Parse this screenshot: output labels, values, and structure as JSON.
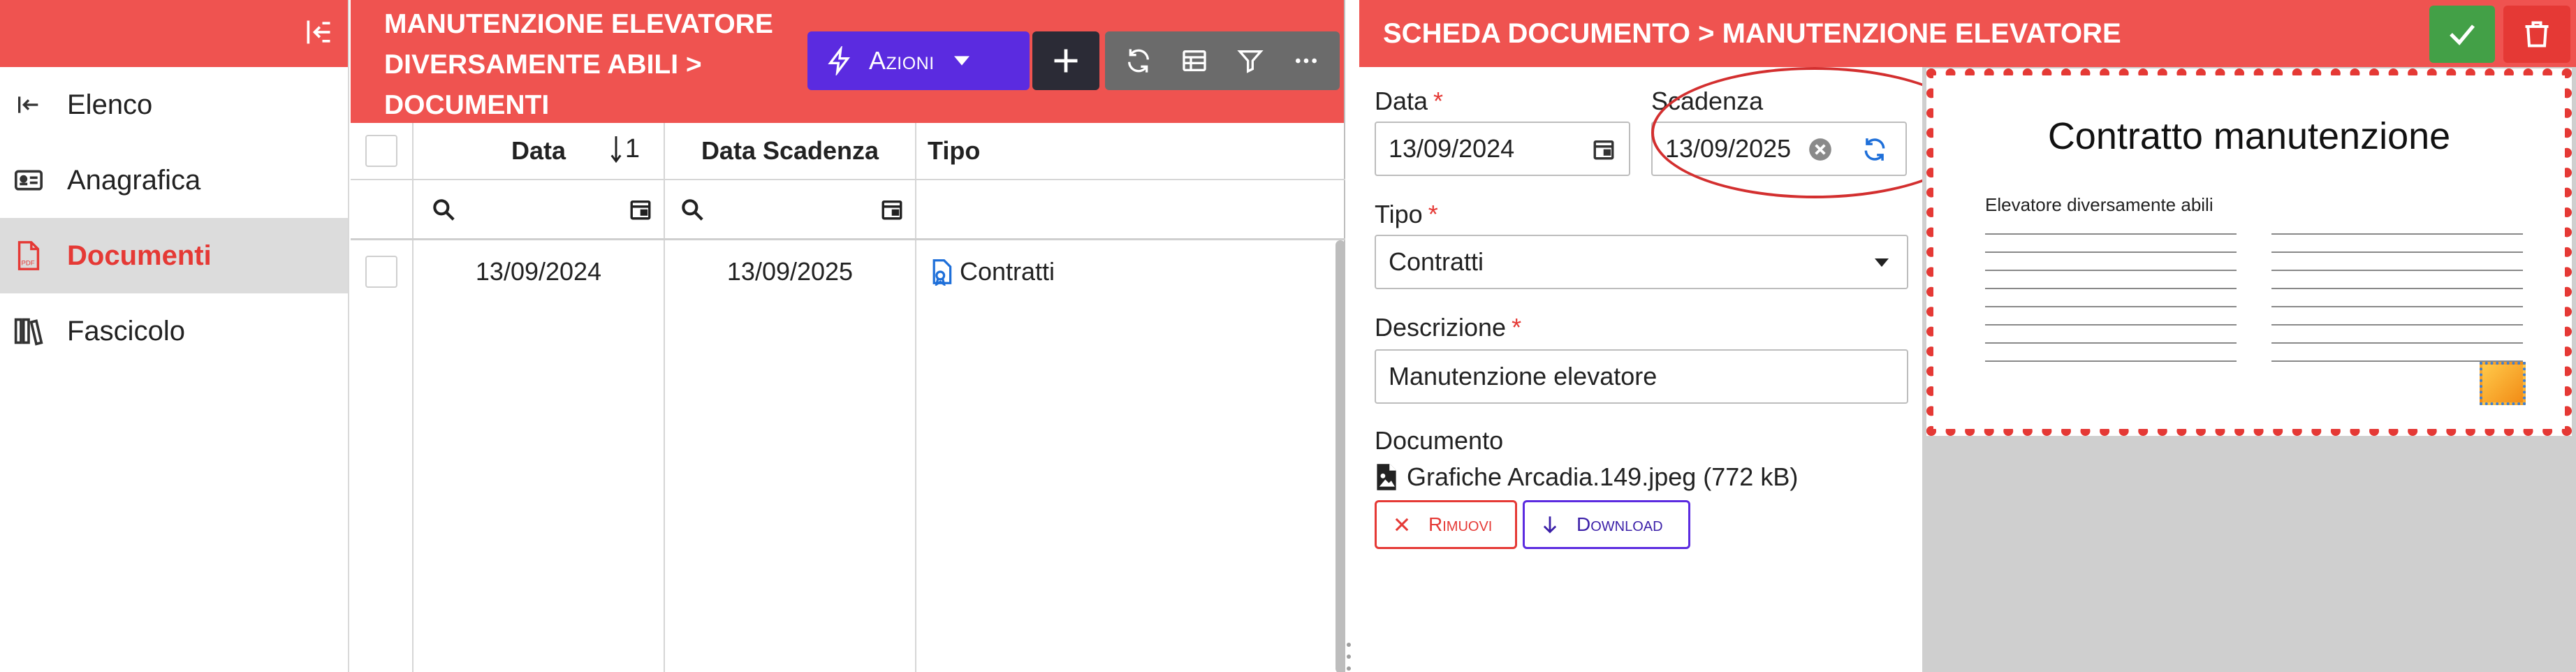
{
  "sidebar": {
    "items": [
      {
        "label": "Elenco",
        "icon": "back-arrow-icon",
        "active": false
      },
      {
        "label": "Anagrafica",
        "icon": "id-card-icon",
        "active": false
      },
      {
        "label": "Documenti",
        "icon": "pdf-file-icon",
        "active": true
      },
      {
        "label": "Fascicolo",
        "icon": "books-icon",
        "active": false
      }
    ]
  },
  "list": {
    "title_lines": [
      "MANUTENZIONE ELEVATORE",
      "DIVERSAMENTE ABILI >",
      "DOCUMENTI"
    ],
    "actions_label": "Azioni",
    "columns": {
      "data": "Data",
      "sort_indicator": "1",
      "scadenza": "Data Scadenza",
      "tipo": "Tipo"
    },
    "rows": [
      {
        "data": "13/09/2024",
        "scadenza": "13/09/2025",
        "tipo": "Contratti"
      }
    ]
  },
  "detail": {
    "title": "SCHEDA DOCUMENTO > MANUTENZIONE ELEVATORE",
    "fields": {
      "data": {
        "label": "Data",
        "value": "13/09/2024"
      },
      "scadenza": {
        "label": "Scadenza",
        "value": "13/09/2025"
      },
      "tipo": {
        "label": "Tipo",
        "value": "Contratti"
      },
      "descrizione": {
        "label": "Descrizione",
        "value": "Manutenzione elevatore"
      }
    },
    "required_mark": "*",
    "documento": {
      "label": "Documento",
      "filename": "Grafiche Arcadia.149.jpeg (772 kB)"
    },
    "buttons": {
      "remove": "Rimuovi",
      "download": "Download"
    },
    "preview": {
      "title": "Contratto manutenzione",
      "subtitle": "Elevatore diversamente abili"
    }
  },
  "colors": {
    "header_red": "#ef5350",
    "accent_purple": "#5b2be0",
    "confirm_green": "#43a047",
    "delete_red": "#e53935"
  }
}
